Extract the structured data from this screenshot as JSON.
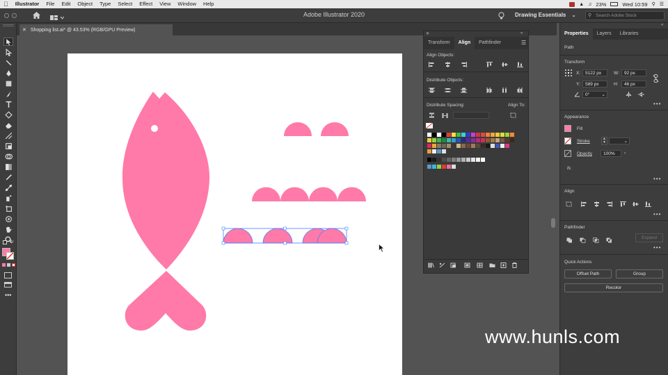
{
  "menubar": {
    "app_name": "Illustrator",
    "items": [
      "File",
      "Edit",
      "Object",
      "Type",
      "Select",
      "Effect",
      "View",
      "Window",
      "Help"
    ],
    "battery": "23%",
    "clock": "Wed 10:59"
  },
  "appbar": {
    "title": "Adobe Illustrator 2020",
    "workspace": "Drawing Essentials",
    "search_placeholder": "Search Adobe Stock"
  },
  "document_tab": {
    "label": "Shopping list.ai* @ 43.53% (RGB/GPU Preview)"
  },
  "align_panel": {
    "tabs": [
      "Transform",
      "Align",
      "Pathfinder"
    ],
    "active_tab": "Align",
    "align_objects_label": "Align Objects:",
    "distribute_objects_label": "Distribute Objects:",
    "distribute_spacing_label": "Distribute Spacing:",
    "align_to_label": "Align To:"
  },
  "properties": {
    "tabs": [
      "Properties",
      "Layers",
      "Libraries"
    ],
    "active_tab": "Properties",
    "object_type": "Path",
    "transform_label": "Transform",
    "x_label": "X:",
    "x_value": "5122 px",
    "y_label": "Y:",
    "y_value": "589 px",
    "w_label": "W:",
    "w_value": "92 px",
    "h_label": "H:",
    "h_value": "46 px",
    "rotation_value": "0°",
    "appearance_label": "Appearance",
    "fill_label": "Fill",
    "stroke_label": "Stroke",
    "opacity_label": "Opacity",
    "opacity_value": "100%",
    "fx_label": "fx.",
    "align_label": "Align",
    "pathfinder_label": "Pathfinder",
    "expand_label": "Expand",
    "quick_actions_label": "Quick Actions",
    "offset_path_label": "Offset Path",
    "group_label": "Group",
    "recolor_label": "Recolor"
  },
  "colors": {
    "accent_pink": "#ff7aa8",
    "selection_blue": "#4a7bff",
    "ui_dark": "#3d3d3d",
    "canvas_gray": "#535353"
  },
  "watermark": "www.hunls.com"
}
